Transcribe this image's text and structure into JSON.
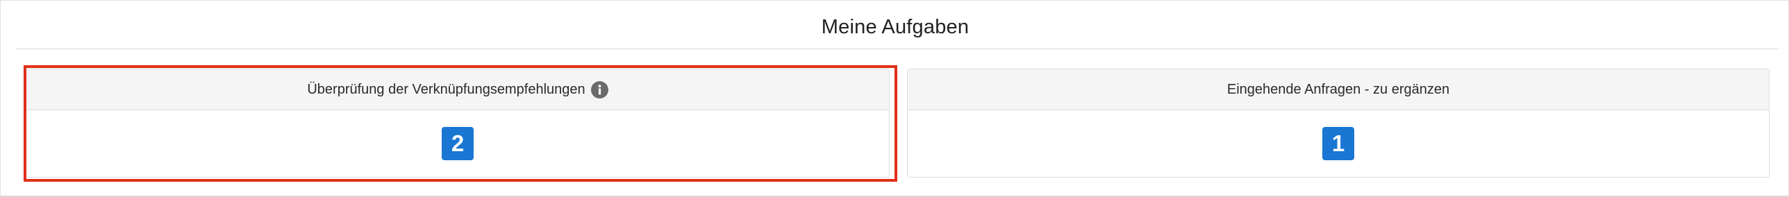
{
  "panel": {
    "title": "Meine Aufgaben"
  },
  "cards": [
    {
      "title": "Überprüfung der Verknüpfungsempfehlungen",
      "count": "2",
      "has_info_icon": true,
      "highlighted": true
    },
    {
      "title": "Eingehende Anfragen - zu ergänzen",
      "count": "1",
      "has_info_icon": false,
      "highlighted": false
    }
  ],
  "colors": {
    "badge": "#1976d2",
    "highlight_border": "#e03017",
    "header_bg": "#f5f5f5",
    "info_icon": "#6b6b6b"
  },
  "icons": {
    "info": "info-icon"
  }
}
